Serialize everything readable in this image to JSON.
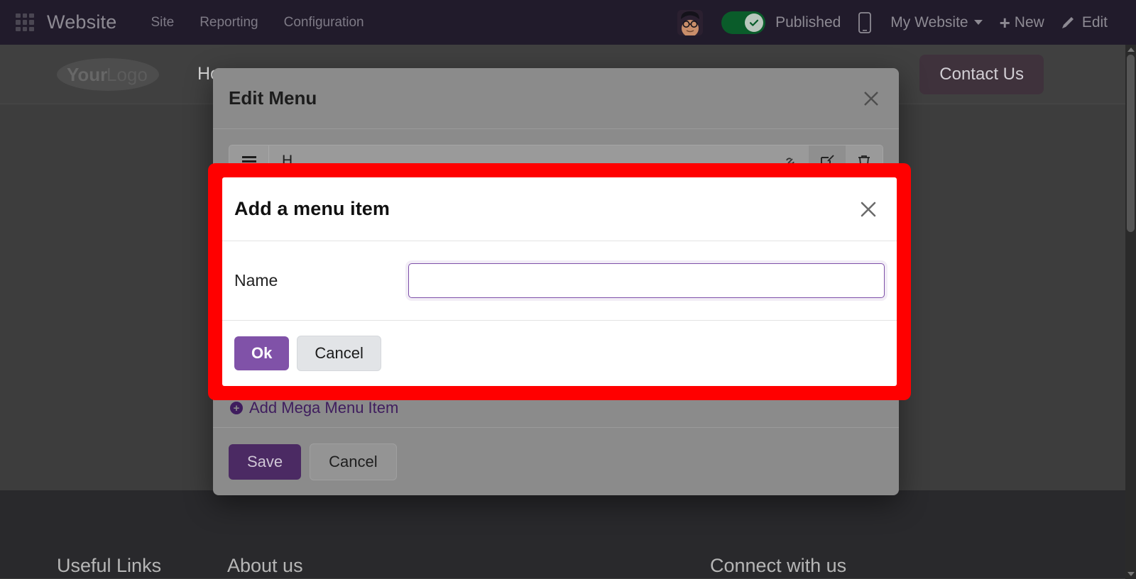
{
  "topbar": {
    "apps_icon": "apps-grid-icon",
    "brand": "Website",
    "menu": [
      {
        "label": "Site"
      },
      {
        "label": "Reporting"
      },
      {
        "label": "Configuration"
      }
    ],
    "avatar": "user-avatar",
    "publish_status": "Published",
    "publish_toggle_state": "on",
    "mobile_icon": "mobile-preview-icon",
    "site_selector": "My Website",
    "new_label": "New",
    "new_icon": "plus-icon",
    "edit_label": "Edit",
    "edit_icon": "pencil-icon",
    "colors": {
      "bar_bg": "#211b2b",
      "text": "#8d8a93",
      "toggle_on": "#0a5c2a"
    }
  },
  "site": {
    "logo_text_bold": "Your",
    "logo_text_light": "Logo",
    "nav": [
      {
        "label": "Ho"
      }
    ],
    "contact_button": "Contact Us",
    "footer": {
      "columns": [
        {
          "title": "Useful Links"
        },
        {
          "title": "About us"
        },
        {
          "title": "Connect with us"
        }
      ]
    }
  },
  "edit_menu_dialog": {
    "title": "Edit Menu",
    "close_icon": "close-icon",
    "rows": [
      {
        "drag_icon": "drag-handle-icon",
        "label": "H",
        "link_icon": "link-icon",
        "edit_icon": "edit-square-icon",
        "delete_icon": "trash-icon"
      }
    ],
    "add_mega_menu_label": "Add Mega Menu Item",
    "add_icon": "plus-circle-icon",
    "save_label": "Save",
    "cancel_label": "Cancel"
  },
  "highlight": {
    "color": "#ff0000"
  },
  "add_menu_item_modal": {
    "title": "Add a menu item",
    "close_icon": "close-icon",
    "name_label": "Name",
    "name_value": "",
    "name_placeholder": "",
    "ok_label": "Ok",
    "cancel_label": "Cancel",
    "accent_color": "#8052a8"
  },
  "scrollbar": {
    "up_arrow_icon": "scroll-up-arrow-icon",
    "down_arrow_icon": "scroll-down-arrow-icon",
    "thumb": "scroll-thumb"
  }
}
